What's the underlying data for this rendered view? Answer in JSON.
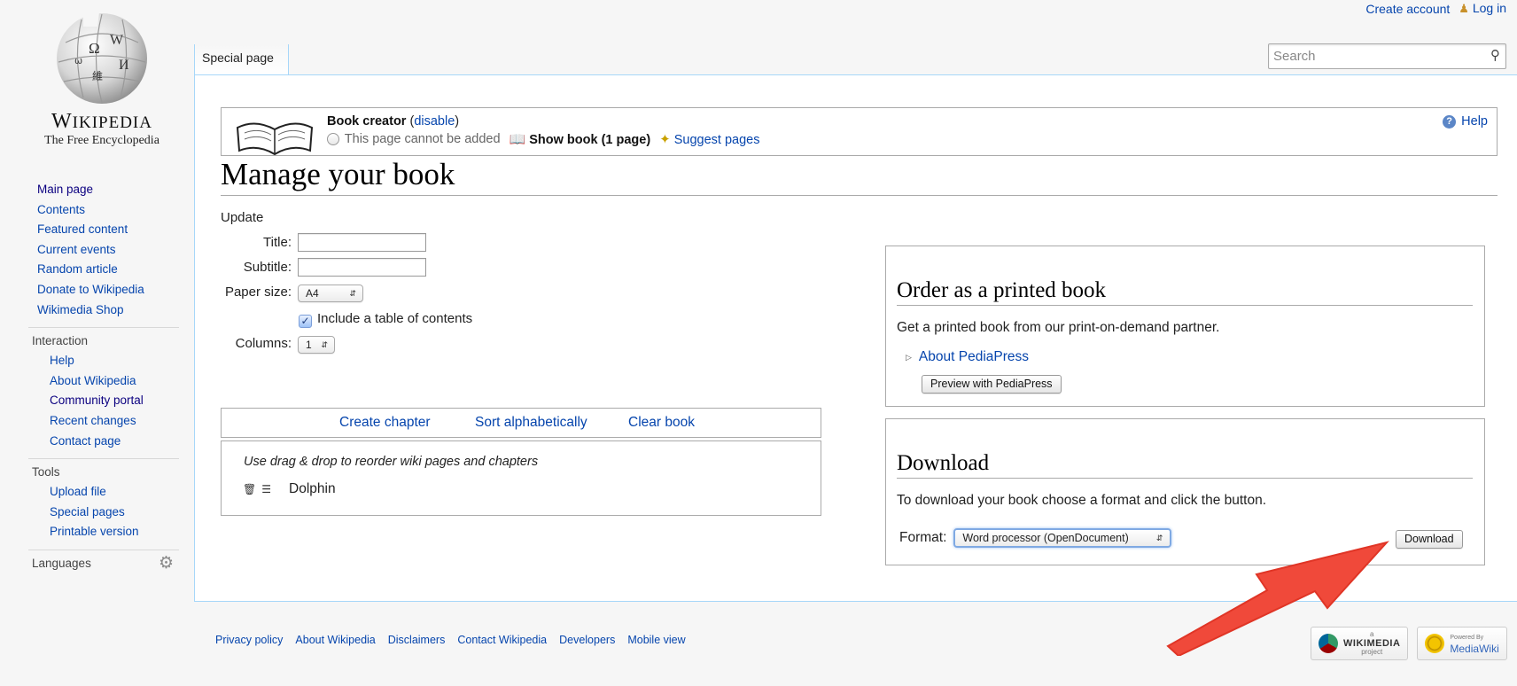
{
  "personal": {
    "create_account": "Create account",
    "log_in": "Log in"
  },
  "logo": {
    "wordmark_first": "W",
    "wordmark_rest": "IKIPEDIA",
    "tagline": "The Free Encyclopedia"
  },
  "sidebar": {
    "main": [
      "Main page",
      "Contents",
      "Featured content",
      "Current events",
      "Random article",
      "Donate to Wikipedia",
      "Wikimedia Shop"
    ],
    "interaction": {
      "heading": "Interaction",
      "items": [
        "Help",
        "About Wikipedia",
        "Community portal",
        "Recent changes",
        "Contact page"
      ]
    },
    "tools": {
      "heading": "Tools",
      "items": [
        "Upload file",
        "Special pages",
        "Printable version"
      ]
    },
    "languages": {
      "heading": "Languages"
    }
  },
  "tabs": {
    "special": "Special page"
  },
  "search": {
    "placeholder": "Search"
  },
  "bookbar": {
    "title": "Book creator",
    "disable": "disable",
    "cannot_add": "This page cannot be added",
    "show_book": "Show book (1 page)",
    "suggest": "Suggest pages",
    "help": "Help"
  },
  "heading": "Manage your book",
  "form": {
    "update": "Update",
    "title_label": "Title:",
    "subtitle_label": "Subtitle:",
    "paper_label": "Paper size:",
    "paper_value": "A4",
    "toc_label": "Include a table of contents",
    "columns_label": "Columns:",
    "columns_value": "1"
  },
  "toolbar": {
    "create_chapter": "Create chapter",
    "sort": "Sort alphabetically",
    "clear": "Clear book"
  },
  "list": {
    "hint": "Use drag & drop to reorder wiki pages and chapters",
    "items": [
      "Dolphin"
    ]
  },
  "print": {
    "heading": "Order as a printed book",
    "text": "Get a printed book from our print-on-demand partner.",
    "about": "About PediaPress",
    "button": "Preview with PediaPress"
  },
  "download": {
    "heading": "Download",
    "text": "To download your book choose a format and click the button.",
    "format_label": "Format:",
    "format_value": "Word processor (OpenDocument)",
    "button": "Download"
  },
  "footer": [
    "Privacy policy",
    "About Wikipedia",
    "Disclaimers",
    "Contact Wikipedia",
    "Developers",
    "Mobile view"
  ],
  "badges": {
    "wikimedia_small": "a",
    "wikimedia": "WIKIMEDIA",
    "wikimedia_sub": "project",
    "mediawiki_small": "Powered By",
    "mediawiki": "MediaWiki"
  },
  "colors": {
    "link": "#0645ad",
    "visited": "#0b0080",
    "arrow": "#f0493a",
    "border": "#a7d7f9"
  }
}
